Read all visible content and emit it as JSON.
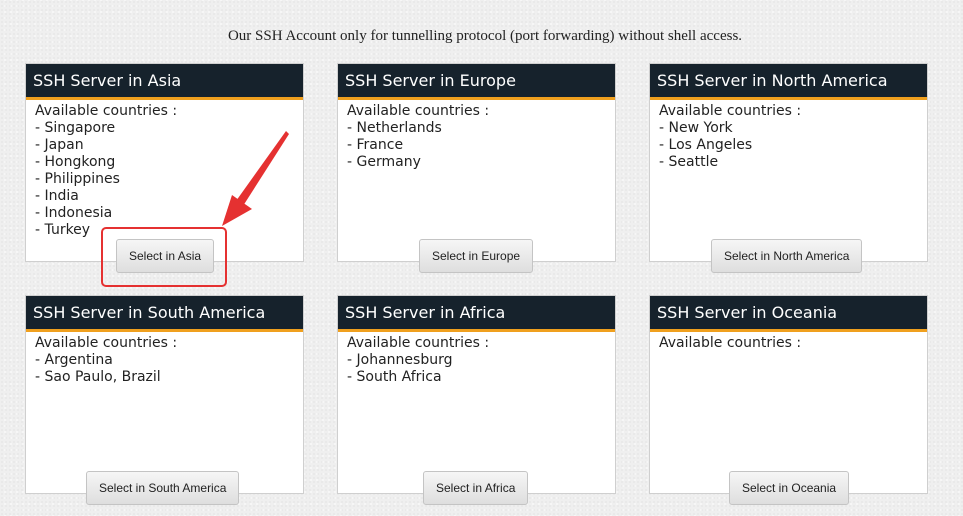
{
  "intro_text": "Our SSH Account only for tunnelling protocol (port forwarding) without shell access.",
  "available_label": "Available countries :",
  "colors": {
    "header_bg": "#16222c",
    "header_accent": "#f0a01e",
    "highlight": "#e53131"
  },
  "servers": [
    {
      "title": "SSH Server in Asia",
      "countries": [
        "Singapore",
        "Japan",
        "Hongkong",
        "Philippines",
        "India",
        "Indonesia",
        "Turkey"
      ],
      "button": "Select in Asia"
    },
    {
      "title": "SSH Server in Europe",
      "countries": [
        "Netherlands",
        "France",
        "Germany"
      ],
      "button": "Select in Europe"
    },
    {
      "title": "SSH Server in North America",
      "countries": [
        "New York",
        "Los Angeles",
        "Seattle"
      ],
      "button": "Select in North America"
    },
    {
      "title": "SSH Server in South America",
      "countries": [
        "Argentina",
        "Sao Paulo, Brazil"
      ],
      "button": "Select in South America"
    },
    {
      "title": "SSH Server in Africa",
      "countries": [
        "Johannesburg",
        "South Africa"
      ],
      "button": "Select in Africa"
    },
    {
      "title": "SSH Server in Oceania",
      "countries": [],
      "button": "Select in Oceania"
    }
  ]
}
